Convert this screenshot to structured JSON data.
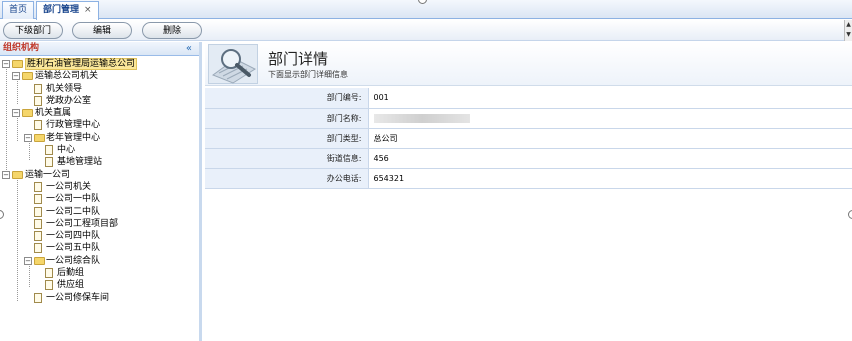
{
  "tabs": [
    {
      "label": "首页"
    },
    {
      "label": "部门管理",
      "close": "×"
    }
  ],
  "toolbar": {
    "sub_dept_label": "下级部门",
    "edit_label": "编辑",
    "delete_label": "删除",
    "scroll_up": "▲",
    "scroll_down": "▼"
  },
  "tree_panel": {
    "title": "组织机构",
    "collapse_icon": "«",
    "nodes": [
      {
        "label": "胜利石油管理局运输总公司"
      },
      {
        "label": "运输总公司机关"
      },
      {
        "label": "机关领导"
      },
      {
        "label": "党政办公室"
      },
      {
        "label": "机关直属"
      },
      {
        "label": "行政管理中心"
      },
      {
        "label": "老年管理中心"
      },
      {
        "label": "中心"
      },
      {
        "label": "基地管理站"
      },
      {
        "label": "运输一公司"
      },
      {
        "label": "一公司机关"
      },
      {
        "label": "一公司一中队"
      },
      {
        "label": "一公司二中队"
      },
      {
        "label": "一公司工程项目部"
      },
      {
        "label": "一公司四中队"
      },
      {
        "label": "一公司五中队"
      },
      {
        "label": "一公司综合队"
      },
      {
        "label": "后勤组"
      },
      {
        "label": "供应组"
      },
      {
        "label": "一公司修保车间"
      }
    ]
  },
  "detail": {
    "title": "部门详情",
    "subtitle": "下面显示部门详细信息",
    "fields": [
      {
        "label": "部门编号:",
        "value": "001"
      },
      {
        "label": "部门名称:",
        "value": ""
      },
      {
        "label": "部门类型:",
        "value": "总公司"
      },
      {
        "label": "街道信息:",
        "value": "456"
      },
      {
        "label": "办公电话:",
        "value": "654321"
      }
    ]
  },
  "colors": {
    "accent": "#15428b",
    "tree_title": "#c0392b",
    "selected_bg": "#fbe79a"
  }
}
